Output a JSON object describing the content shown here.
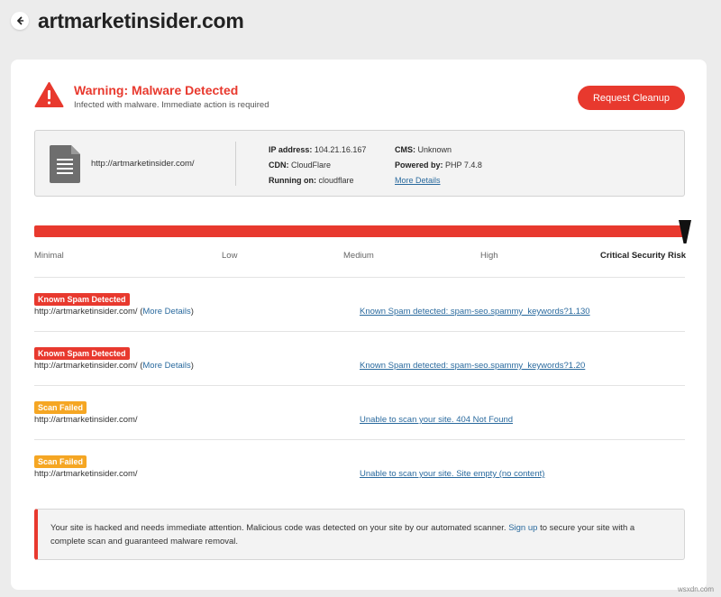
{
  "header": {
    "title": "artmarketinsider.com"
  },
  "warning": {
    "title": "Warning: Malware Detected",
    "subtitle": "Infected with malware. Immediate action is required",
    "cleanup_button": "Request Cleanup"
  },
  "info": {
    "url": "http://artmarketinsider.com/",
    "ip_label": "IP address:",
    "ip_value": "104.21.16.167",
    "cdn_label": "CDN:",
    "cdn_value": "CloudFlare",
    "running_label": "Running on:",
    "running_value": "cloudflare",
    "cms_label": "CMS:",
    "cms_value": "Unknown",
    "powered_label": "Powered by:",
    "powered_value": "PHP 7.4.8",
    "more_details": "More Details"
  },
  "risk": {
    "level_fraction": 1.0,
    "labels": [
      "Minimal",
      "Low",
      "Medium",
      "High",
      "Critical Security Risk"
    ],
    "active": "Critical Security Risk"
  },
  "findings": [
    {
      "badge": "Known Spam Detected",
      "badge_color": "#e8392e",
      "url": "http://artmarketinsider.com/",
      "open": " (",
      "more": "More Details",
      "close": ")",
      "detail": "Known Spam detected: spam-seo.spammy_keywords?1.130"
    },
    {
      "badge": "Known Spam Detected",
      "badge_color": "#e8392e",
      "url": "http://artmarketinsider.com/",
      "open": " (",
      "more": "More Details",
      "close": ")",
      "detail": "Known Spam detected: spam-seo.spammy_keywords?1.20"
    },
    {
      "badge": "Scan Failed",
      "badge_color": "#f5a623",
      "url": "http://artmarketinsider.com/",
      "detail": "Unable to scan your site. 404 Not Found"
    },
    {
      "badge": "Scan Failed",
      "badge_color": "#f5a623",
      "url": "http://artmarketinsider.com/",
      "detail": "Unable to scan your site. Site empty (no content)"
    }
  ],
  "alert": {
    "text_before": "Your site is hacked and needs immediate attention. Malicious code was detected on your site by our automated scanner. ",
    "link": "Sign up",
    "text_after": " to secure your site with a complete scan and guaranteed malware removal."
  },
  "watermark": "wsxdn.com",
  "colors": {
    "accent": "#e8392e",
    "warning": "#f5a623",
    "link": "#2a6a9e"
  }
}
